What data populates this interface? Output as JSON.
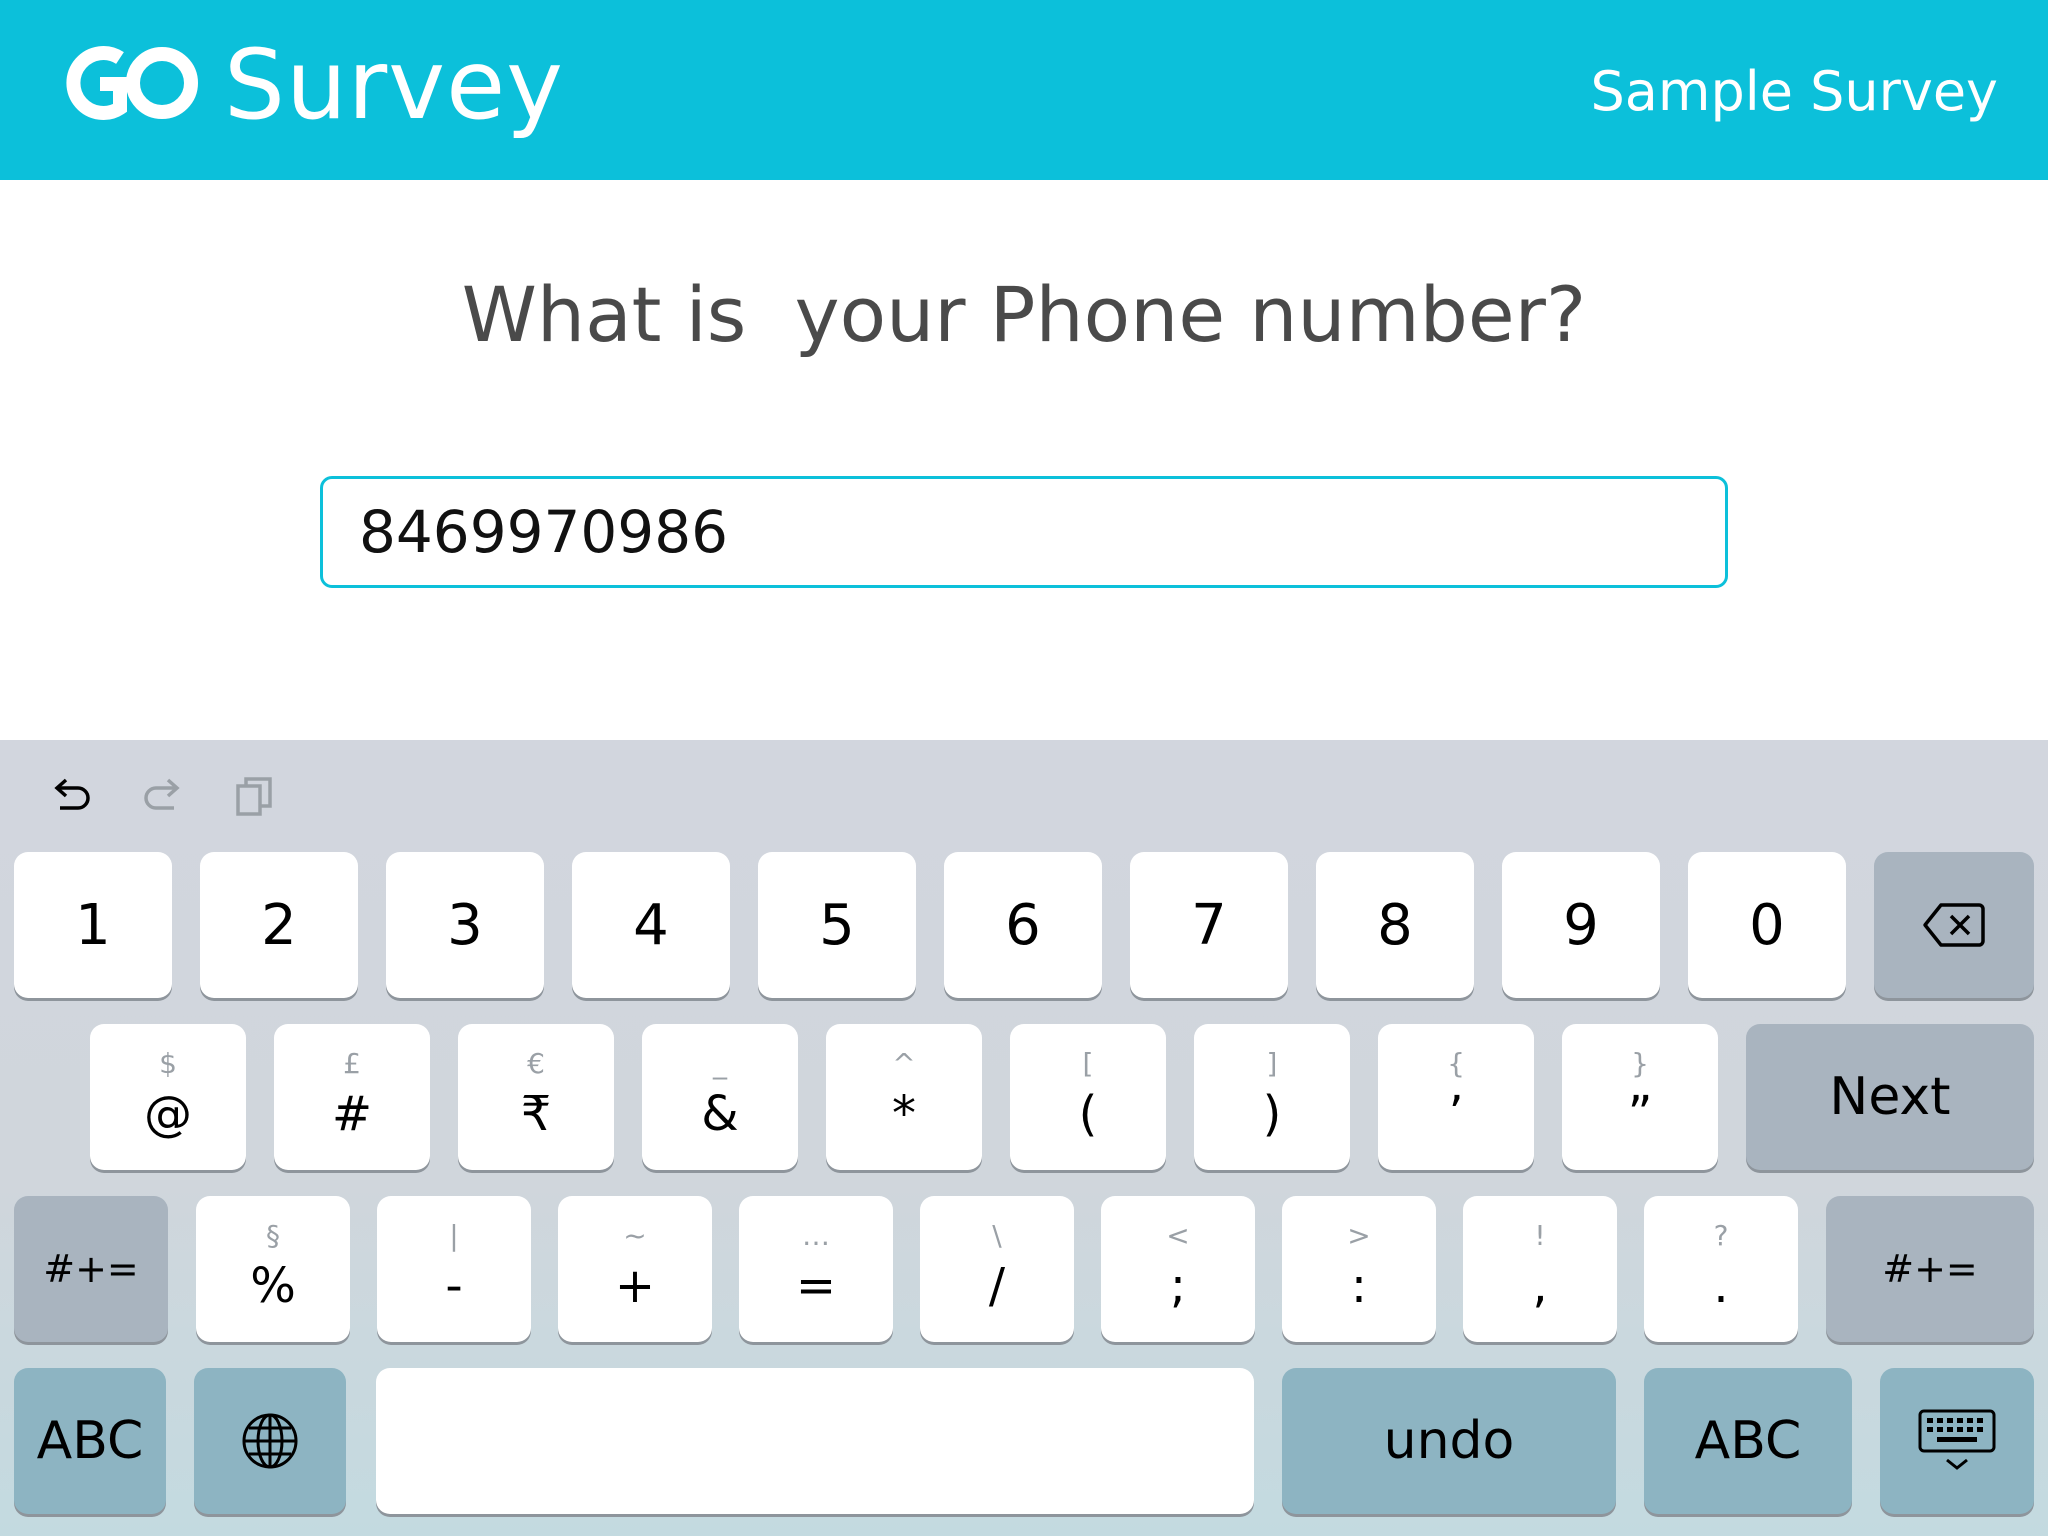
{
  "header": {
    "app_name": "Survey",
    "survey_name": "Sample Survey",
    "logo_icon": "go-logo-icon",
    "bg_color": "#0cc0da"
  },
  "main": {
    "question": "What is  your Phone number?",
    "answer_value": "8469970986",
    "accent_color": "#0cc0da"
  },
  "keyboard": {
    "toolbar": {
      "undo_icon": "undo-icon",
      "redo_icon": "redo-icon",
      "paste_icon": "paste-icon"
    },
    "row1": [
      "1",
      "2",
      "3",
      "4",
      "5",
      "6",
      "7",
      "8",
      "9",
      "0"
    ],
    "backspace_icon": "backspace-icon",
    "row2": [
      {
        "alt": "$",
        "main": "@"
      },
      {
        "alt": "£",
        "main": "#"
      },
      {
        "alt": "€",
        "main": "₹"
      },
      {
        "alt": "_",
        "main": "&"
      },
      {
        "alt": "^",
        "main": "*"
      },
      {
        "alt": "[",
        "main": "("
      },
      {
        "alt": "]",
        "main": ")"
      },
      {
        "alt": "{",
        "main": "’"
      },
      {
        "alt": "}",
        "main": "”"
      }
    ],
    "next_label": "Next",
    "shift_left": "#+=",
    "shift_right": "#+=",
    "row3": [
      {
        "alt": "§",
        "main": "%"
      },
      {
        "alt": "|",
        "main": "-"
      },
      {
        "alt": "~",
        "main": "+"
      },
      {
        "alt": "…",
        "main": "="
      },
      {
        "alt": "\\",
        "main": "/"
      },
      {
        "alt": "<",
        "main": ";"
      },
      {
        "alt": ">",
        "main": ":"
      },
      {
        "alt": "!",
        "main": ","
      },
      {
        "alt": "?",
        "main": "."
      }
    ],
    "abc_left": "ABC",
    "globe_icon": "globe-icon",
    "space_label": "",
    "undo_label": "undo",
    "abc_right": "ABC",
    "dismiss_icon": "keyboard-dismiss-icon"
  }
}
